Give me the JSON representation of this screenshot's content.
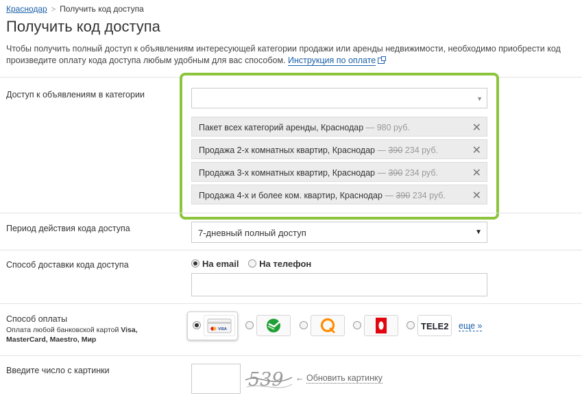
{
  "breadcrumb": {
    "home": "Краснодар",
    "separator": ">",
    "current": "Получить код доступа"
  },
  "page_title": "Получить код доступа",
  "intro": {
    "line1": "Чтобы получить полный доступ к объявлениям интересующей категории продажи или аренды недвижимости, необходимо приобрести код",
    "line2": "произведите оплату кода доступа любым удобным для вас способом.",
    "link": "Инструкция по оплате"
  },
  "categories": {
    "label": "Доступ к объявлениям в категории",
    "select_value": "",
    "items": [
      {
        "name": "Пакет всех категорий аренды, Краснодар",
        "dash": "—",
        "old_price": "",
        "price": "980 руб."
      },
      {
        "name": "Продажа 2-х комнатных квартир, Краснодар",
        "dash": "—",
        "old_price": "390",
        "price": "234 руб."
      },
      {
        "name": "Продажа 3-х комнатных квартир, Краснодар",
        "dash": "—",
        "old_price": "390",
        "price": "234 руб."
      },
      {
        "name": "Продажа 4-х и более ком. квартир, Краснодар",
        "dash": "—",
        "old_price": "390",
        "price": "234 руб."
      }
    ],
    "remove_glyph": "✕"
  },
  "period": {
    "label": "Период действия кода доступа",
    "value": "7-дневный полный доступ"
  },
  "delivery": {
    "label": "Способ доставки кода доступа",
    "options": [
      "На email",
      "На телефон"
    ],
    "selected": "На email",
    "input_value": ""
  },
  "payment": {
    "label": "Способ оплаты",
    "sublabel_prefix": "Оплата любой банковской картой",
    "sublabel_cards": "Visa, MasterCard, Maestro, Мир",
    "methods": [
      {
        "icon": "bank-card-icon",
        "selected": true
      },
      {
        "icon": "sberbank-icon",
        "selected": false
      },
      {
        "icon": "qiwi-icon",
        "selected": false
      },
      {
        "icon": "mts-icon",
        "selected": false
      },
      {
        "icon": "tele2-icon",
        "selected": false,
        "text": "TELE2"
      }
    ],
    "card_brand": "VISA",
    "more": "еще »",
    "colors": {
      "sber": "#21a038",
      "qiwi": "#ff8c00",
      "mts": "#e30611",
      "tele2": "#1f2229"
    }
  },
  "captcha": {
    "label": "Введите число с картинки",
    "image_text": "539",
    "arrow": "←",
    "refresh": "Обновить картинку"
  },
  "colors": {
    "accent_green": "#8cc43b",
    "link_blue": "#1a5fa8"
  }
}
